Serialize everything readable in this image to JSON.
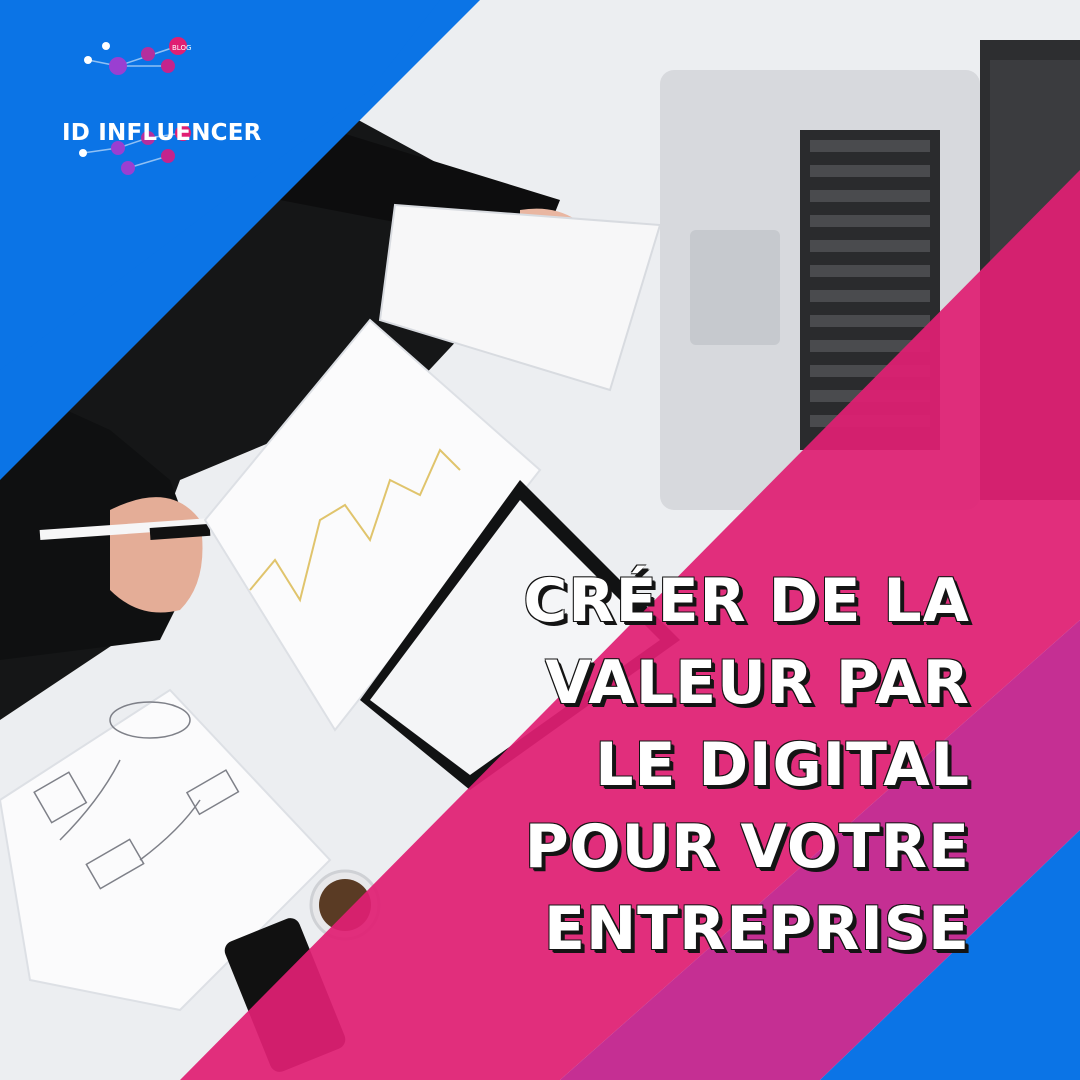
{
  "brand": {
    "name": "ID INFLUENCER",
    "badge": "BLOG",
    "colors": {
      "blue": "#0b74e6",
      "pink": "#e01f73",
      "magenta": "#c3248d",
      "logo_node": "#8a2bbd"
    }
  },
  "headline": {
    "lines": [
      "CRÉER DE LA",
      "VALEUR PAR",
      "LE DIGITAL",
      "POUR VOTRE",
      "ENTREPRISE"
    ]
  },
  "photo": {
    "icons": [
      "laptop-icon",
      "notebook-icon",
      "pen-icon",
      "smartphone-icon",
      "coffee-cup-icon",
      "clipboard-icon"
    ]
  }
}
